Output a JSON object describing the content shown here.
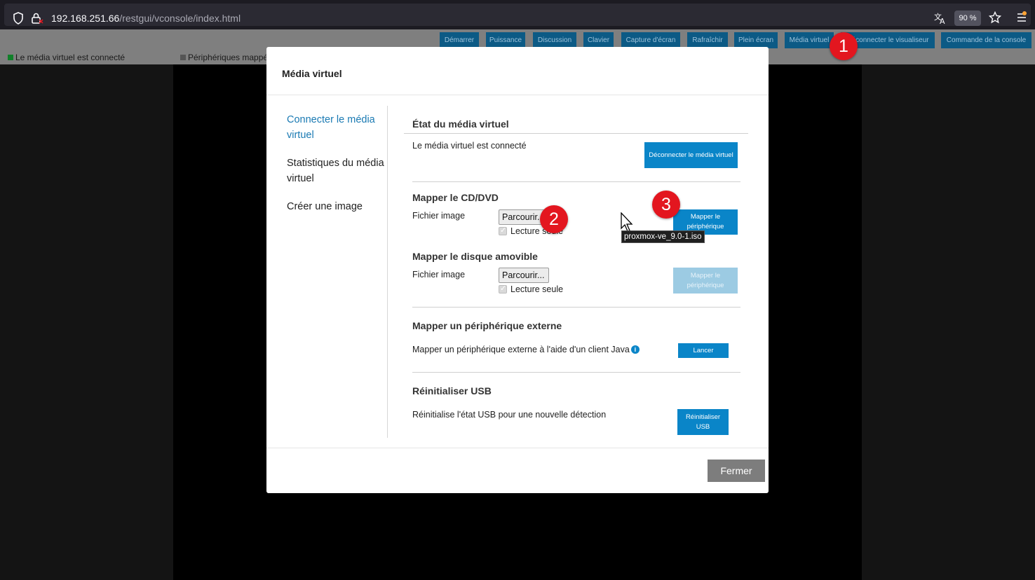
{
  "browser": {
    "url_host": "192.168.251.66",
    "url_path": "/restgui/vconsole/index.html",
    "zoom": "90 %",
    "icons": [
      "shield-icon",
      "lock-icon",
      "translate-icon",
      "star-icon",
      "hamburger-menu-icon"
    ]
  },
  "vconsole": {
    "toolbar": [
      "Démarrer",
      "Puissance",
      "Discussion",
      "Clavier",
      "Capture d'écran",
      "Rafraîchir",
      "Plein écran",
      "Média virtuel",
      "Déconnecter le visualiseur",
      "Commande de la console"
    ],
    "status": {
      "vmedia": "Le média virtuel est connecté",
      "devices": "Périphériques mappés"
    },
    "colors": {
      "status_connected": "#11802a",
      "status_devices": "#555555"
    }
  },
  "modal": {
    "title": "Média virtuel",
    "nav": [
      "Connecter le média virtuel",
      "Statistiques du média virtuel",
      "Créer une image"
    ],
    "state_section": {
      "title": "État du média virtuel",
      "text": "Le média virtuel est connecté",
      "button": "Déconnecter le média virtuel"
    },
    "cd_section": {
      "title": "Mapper le CD/DVD",
      "label": "Fichier image",
      "browse": "Parcourir...",
      "readonly": "Lecture seule",
      "button": "Mapper le périphérique"
    },
    "removable_section": {
      "title": "Mapper le disque amovible",
      "label": "Fichier image",
      "browse": "Parcourir...",
      "readonly": "Lecture seule",
      "button": "Mapper le périphérique"
    },
    "external_section": {
      "title": "Mapper un périphérique externe",
      "text": "Mapper un périphérique externe à l'aide d'un client Java",
      "button": "Lancer"
    },
    "usb_section": {
      "title": "Réinitialiser USB",
      "text": "Réinitialise l'état USB pour une nouvelle détection",
      "button": "Réinitialiser USB"
    },
    "close": "Fermer"
  },
  "tooltip": "proxmox-ve_9.0-1.iso",
  "markers": [
    "1",
    "2",
    "3"
  ],
  "accent": "#0a85c8",
  "marker_color": "#e3161f"
}
